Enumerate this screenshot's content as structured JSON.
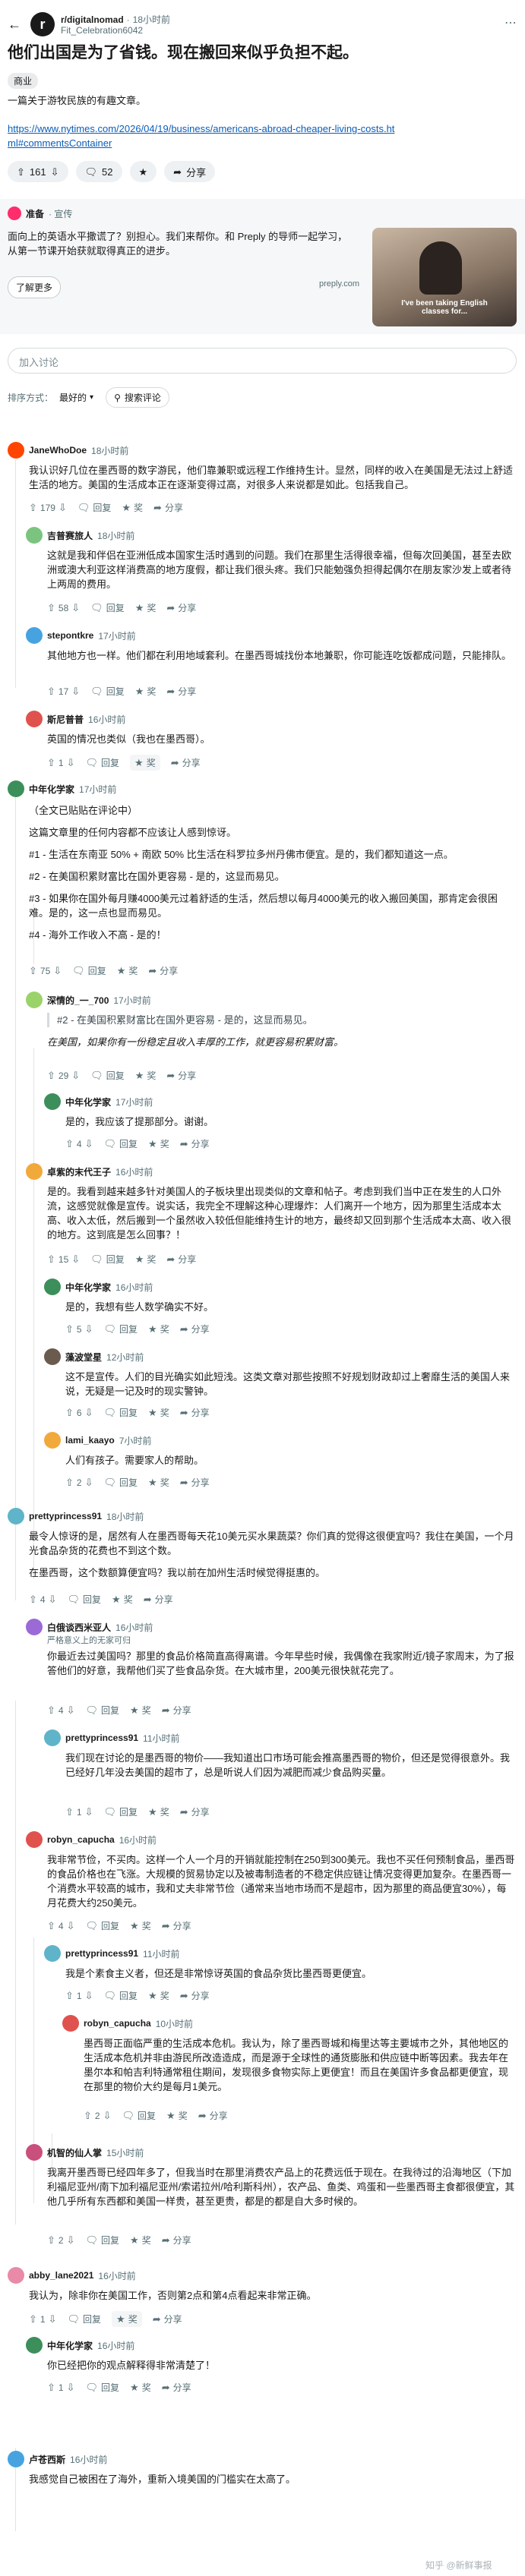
{
  "header": {
    "back_icon": "arrow-left-icon",
    "subreddit": "r/digitalnomad",
    "post_time": "18小时前",
    "author": "Fit_Celebration6042",
    "more_icon": "ellipsis-icon"
  },
  "post": {
    "title": "他们出国是为了省钱。现在搬回来似乎负担不起。",
    "flair": "商业",
    "subtitle": "一篇关于游牧民族的有趣文章。",
    "link": "https://www.nytimes.com/2026/04/19/business/americans-abroad-cheaper-living-costs.html#commentsContainer",
    "votes": "161",
    "comments": "52",
    "share": "分享"
  },
  "ad": {
    "brand": "准备",
    "promoted": "· 宣传",
    "text": "面向上的英语水平撒谎了？别担心。我们来帮你。和 Preply 的导师一起学习，从第一节课开始获就取得真正的进步。",
    "cta": "了解更多",
    "domain": "preply.com",
    "caption": "I've been taking English classes for..."
  },
  "comment_box": {
    "placeholder": "加入讨论"
  },
  "sort": {
    "label": "排序方式：",
    "value": "最好的",
    "search": "搜索评论"
  },
  "comments": [
    {
      "author": "JaneWhoDoe",
      "time": "18小时前",
      "body": [
        "我认识好几位在墨西哥的数字游民，他们靠兼职或远程工作维持生计。显然，同样的收入在美国是无法过上舒适生活的地方。美国的生活成本正在逐渐变得过高，对很多人来说都是如此。包括我自己。"
      ],
      "votes": "179",
      "reply": "回复",
      "award": "奖",
      "share": "分享"
    },
    {
      "author": "吉普赛旅人",
      "time": "18小时前",
      "body": [
        "这就是我和伴侣在亚洲低成本国家生活时遇到的问题。我们在那里生活得很幸福，但每次回美国，甚至去欧洲或澳大利亚这样消费高的地方度假，都让我们很头疼。我们只能勉强负担得起偶尔在朋友家沙发上或者待上两周的费用。"
      ],
      "votes": "58",
      "reply": "回复",
      "award": "奖",
      "share": "分享"
    },
    {
      "author": "stepontkre",
      "time": "17小时前",
      "body": [
        "其他地方也一样。他们都在利用地域套利。在墨西哥城找份本地兼职，你可能连吃饭都成问题，只能排队。"
      ],
      "votes": "17",
      "reply": "回复",
      "award": "奖",
      "share": "分享"
    },
    {
      "author": "斯尼普普",
      "time": "16小时前",
      "body": [
        "英国的情况也类似（我也在墨西哥）。"
      ],
      "votes": "1",
      "reply": "回复",
      "award": "奖",
      "share": "分享"
    },
    {
      "author": "中年化学家",
      "time": "17小时前",
      "body": [
        "（全文已贴贴在评论中）",
        "这篇文章里的任何内容都不应该让人感到惊讶。",
        "#1 - 生活在东南亚 50% + 南欧 50% 比生活在科罗拉多州丹佛市便宜。是的，我们都知道这一点。",
        "#2 - 在美国积累财富比在国外更容易 - 是的，这显而易见。",
        "#3 - 如果你在国外每月赚4000美元过着舒适的生活，然后想以每月4000美元的收入搬回美国，那肯定会很困难。是的，这一点也显而易见。",
        "#4 - 海外工作收入不高 - 是的！"
      ],
      "votes": "75",
      "reply": "回复",
      "award": "奖",
      "share": "分享"
    },
    {
      "author": "深情的_一_700",
      "time": "17小时前",
      "quote": "#2 - 在美国积累财富比在国外更容易 - 是的，这显而易见。",
      "body": [
        "在美国，如果你有一份稳定且收入丰厚的工作，就更容易积累财富。"
      ],
      "votes": "29",
      "reply": "回复",
      "award": "奖",
      "share": "分享"
    },
    {
      "author": "中年化学家",
      "time": "17小时前",
      "body": [
        "是的，我应该了提那部分。谢谢。"
      ],
      "votes": "4",
      "reply": "回复",
      "award": "奖",
      "share": "分享"
    },
    {
      "author": "卓紫的末代王子",
      "time": "16小时前",
      "body": [
        "是的。我看到越来越多针对美国人的子板块里出现类似的文章和帖子。考虑到我们当中正在发生的人口外流，这感觉就像是宣传。说实话，我完全不理解这种心理爆炸：人们离开一个地方，因为那里生活成本太高、收入太低，然后搬到一个虽然收入较低但能维持生计的地方，最终却又回到那个生活成本太高、收入很的地方。这到底是怎么回事？！"
      ],
      "votes": "15",
      "reply": "回复",
      "award": "奖",
      "share": "分享"
    },
    {
      "author": "中年化学家",
      "time": "16小时前",
      "body": [
        "是的，我想有些人数学确实不好。"
      ],
      "votes": "5",
      "reply": "回复",
      "award": "奖",
      "share": "分享"
    },
    {
      "author": "藻波堂星",
      "time": "12小时前",
      "body": [
        "这不是宣传。人们的目光确实如此短浅。这类文章对那些按照不好规划财政却过上奢靡生活的美国人来说，无疑是一记及时的现实警钟。"
      ],
      "votes": "6",
      "reply": "回复",
      "award": "奖",
      "share": "分享"
    },
    {
      "author": "lami_kaayo",
      "time": "7小时前",
      "body": [
        "人们有孩子。需要家人的帮助。"
      ],
      "votes": "2",
      "reply": "回复",
      "award": "奖",
      "share": "分享"
    },
    {
      "author": "prettyprincess91",
      "time": "18小时前",
      "body": [
        "最令人惊讶的是，居然有人在墨西哥每天花10美元买水果蔬菜？你们真的觉得这很便宜吗？我住在美国，一个月光食品杂货的花费也不到这个数。",
        "在墨西哥，这个数额算便宜吗？我以前在加州生活时候觉得挺惠的。"
      ],
      "votes": "4",
      "reply": "回复",
      "award": "奖",
      "share": "分享"
    },
    {
      "author": "白俄谈西米亚人",
      "time": "16小时前",
      "flair": "严格意义上的无家可归",
      "body": [
        "你最近去过美国吗？那里的食品价格简直高得离谱。今年早些时候，我偶像在我家附近/镜子家周末，为了报答他们的好意，我帮他们买了些食品杂货。在大城市里，200美元很快就花完了。"
      ],
      "votes": "4",
      "reply": "回复",
      "award": "奖",
      "share": "分享"
    },
    {
      "author": "prettyprincess91",
      "time": "11小时前",
      "body": [
        "我们现在讨论的是墨西哥的物价——我知道出口市场可能会推高墨西哥的物价，但还是觉得很意外。我已经好几年没去美国的超市了，总是听说人们因为减肥而减少食品购买量。"
      ],
      "votes": "1",
      "reply": "回复",
      "award": "奖",
      "share": "分享"
    },
    {
      "author": "robyn_capucha",
      "time": "16小时前",
      "body": [
        "我非常节俭，不买肉。这样一个人一个月的开销就能控制在250到300美元。我也不买任何预制食品，墨西哥的食品价格也在飞涨。大规模的贸易协定以及被毒制造者的不稳定供应链让情况变得更加复杂。在墨西哥一个消费水平较高的城市，我和丈夫非常节俭（通常来当地市场而不是超市，因为那里的商品便宜30%），每月花费大约250美元。"
      ],
      "votes": "4",
      "reply": "回复",
      "award": "奖",
      "share": "分享"
    },
    {
      "author": "prettyprincess91",
      "time": "11小时前",
      "body": [
        "我是个素食主义者，但还是非常惊讶英国的食品杂货比墨西哥更便宜。"
      ],
      "votes": "1",
      "reply": "回复",
      "award": "奖",
      "share": "分享"
    },
    {
      "author": "robyn_capucha",
      "time": "10小时前",
      "body": [
        "墨西哥正面临严重的生活成本危机。我认为，除了墨西哥城和梅里达等主要城市之外，其他地区的生活成本危机并非由游民所改造造成，而是源于全球性的通货膨胀和供应链中断等因素。我去年在墨尔本和帕吉利特通常租住期间，发现很多食物实际上更便宜！而且在美国许多食品都更便宜，现在那里的物价大约是每月1美元。"
      ],
      "votes": "2",
      "reply": "回复",
      "award": "奖",
      "share": "分享"
    },
    {
      "author": "机智的仙人掌",
      "time": "15小时前",
      "body": [
        "我离开墨西哥已经四年多了，但我当时在那里消费农产品上的花费远低于现在。在我待过的沿海地区（下加利福尼亚州/南下加利福尼亚州/索诺拉州/哈利斯科州），农产品、鱼类、鸡蛋和一些墨西哥主食都很便宜，其他几乎所有东西都和美国一样贵，甚至更贵，都是的都是自大多时候的。"
      ],
      "votes": "2",
      "reply": "回复",
      "award": "奖",
      "share": "分享"
    },
    {
      "author": "abby_lane2021",
      "time": "16小时前",
      "body": [
        "我认为，除非你在美国工作，否则第2点和第4点看起来非常正确。"
      ],
      "votes": "1",
      "reply": "回复",
      "award": "奖",
      "share": "分享"
    },
    {
      "author": "中年化学家",
      "time": "16小时前",
      "body": [
        "你已经把你的观点解释得非常清楚了！"
      ],
      "votes": "1",
      "reply": "回复",
      "award": "奖",
      "share": "分享"
    },
    {
      "author": "卢苍西斯",
      "time": "16小时前",
      "body": [
        "我感觉自己被困在了海外，重新入境美国的门槛实在太高了。"
      ],
      "votes": "",
      "reply": "回复",
      "award": "奖",
      "share": "分享"
    }
  ],
  "watermark": "知乎 @新鲜事报"
}
